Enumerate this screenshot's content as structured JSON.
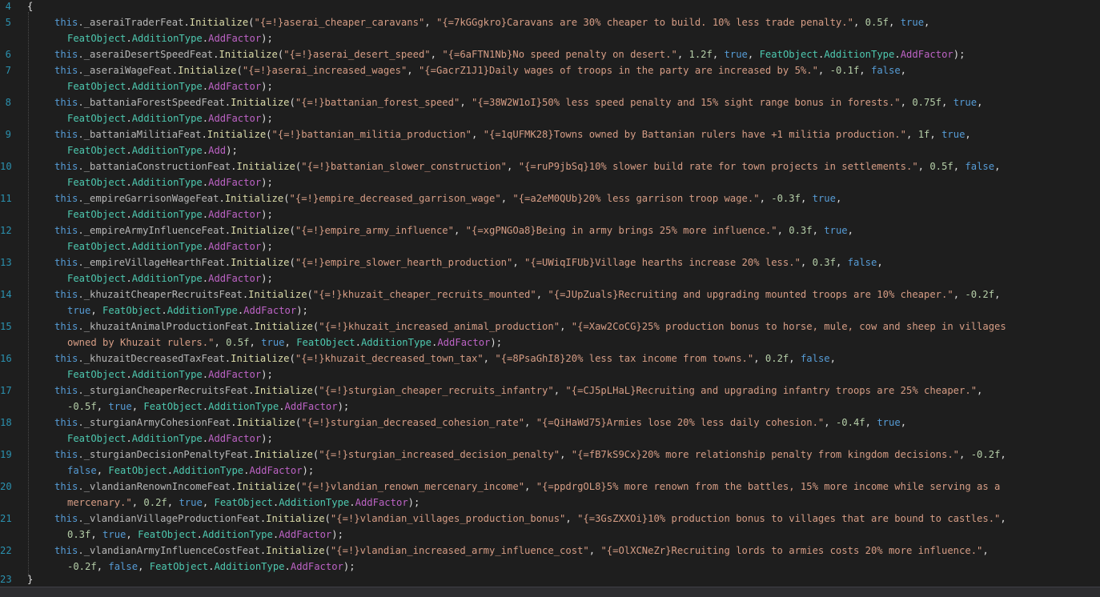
{
  "line_numbers": [
    "4",
    "5",
    "6",
    "7",
    "8",
    "9",
    "10",
    "11",
    "12",
    "13",
    "14",
    "15",
    "16",
    "17",
    "18",
    "19",
    "20",
    "21",
    "22",
    "23"
  ],
  "open_brace": "{",
  "close_brace": "}",
  "rows": [
    {
      "num": "5",
      "a": "this",
      "b": "._aseraiTraderFeat",
      "c": ".Initialize(",
      "d": "\"{=!}aserai_cheaper_caravans\"",
      "e": ", ",
      "f": "\"{=7kGGgkro}Caravans are 30% cheaper to build. 10% less trade penalty.\"",
      "g": ", ",
      "h": "0.5f",
      "i": ", ",
      "j": "true",
      "k": ",",
      "cont": "FeatObject.AdditionType.AddFactor);"
    },
    {
      "num": "6",
      "a": "this",
      "b": "._aseraiDesertSpeedFeat",
      "c": ".Initialize(",
      "d": "\"{=!}aserai_desert_speed\"",
      "e": ", ",
      "f": "\"{=6aFTN1Nb}No speed penalty on desert.\"",
      "g": ", ",
      "h": "1.2f",
      "i": ", ",
      "j": "true",
      "k": ", FeatObject.AdditionType.AddFactor);",
      "cont": ""
    },
    {
      "num": "7",
      "a": "this",
      "b": "._aseraiWageFeat",
      "c": ".Initialize(",
      "d": "\"{=!}aserai_increased_wages\"",
      "e": ", ",
      "f": "\"{=GacrZ1J1}Daily wages of troops in the party are increased by 5%.\"",
      "g": ", ",
      "h": "-0.1f",
      "i": ", ",
      "j": "false",
      "k": ",",
      "cont": "FeatObject.AdditionType.AddFactor);"
    },
    {
      "num": "8",
      "a": "this",
      "b": "._battaniaForestSpeedFeat",
      "c": ".Initialize(",
      "d": "\"{=!}battanian_forest_speed\"",
      "e": ", ",
      "f": "\"{=38W2W1oI}50% less speed penalty and 15% sight range bonus in forests.\"",
      "g": ", ",
      "h": "0.75f",
      "i": ", ",
      "j": "true",
      "k": ",",
      "cont": "FeatObject.AdditionType.AddFactor);"
    },
    {
      "num": "9",
      "a": "this",
      "b": "._battaniaMilitiaFeat",
      "c": ".Initialize(",
      "d": "\"{=!}battanian_militia_production\"",
      "e": ", ",
      "f": "\"{=1qUFMK28}Towns owned by Battanian rulers have +1 militia production.\"",
      "g": ", ",
      "h": "1f",
      "i": ", ",
      "j": "true",
      "k": ",",
      "cont": "FeatObject.AdditionType.Add);"
    },
    {
      "num": "10",
      "a": "this",
      "b": "._battaniaConstructionFeat",
      "c": ".Initialize(",
      "d": "\"{=!}battanian_slower_construction\"",
      "e": ", ",
      "f": "\"{=ruP9jbSq}10% slower build rate for town projects in settlements.\"",
      "g": ", ",
      "h": "0.5f",
      "i": ", ",
      "j": "false",
      "k": ",",
      "cont": "FeatObject.AdditionType.AddFactor);"
    },
    {
      "num": "11",
      "a": "this",
      "b": "._empireGarrisonWageFeat",
      "c": ".Initialize(",
      "d": "\"{=!}empire_decreased_garrison_wage\"",
      "e": ", ",
      "f": "\"{=a2eM0QUb}20% less garrison troop wage.\"",
      "g": ", ",
      "h": "-0.3f",
      "i": ", ",
      "j": "true",
      "k": ",",
      "cont": "FeatObject.AdditionType.AddFactor);"
    },
    {
      "num": "12",
      "a": "this",
      "b": "._empireArmyInfluenceFeat",
      "c": ".Initialize(",
      "d": "\"{=!}empire_army_influence\"",
      "e": ", ",
      "f": "\"{=xgPNGOa8}Being in army brings 25% more influence.\"",
      "g": ", ",
      "h": "0.3f",
      "i": ", ",
      "j": "true",
      "k": ",",
      "cont": "FeatObject.AdditionType.AddFactor);"
    },
    {
      "num": "13",
      "a": "this",
      "b": "._empireVillageHearthFeat",
      "c": ".Initialize(",
      "d": "\"{=!}empire_slower_hearth_production\"",
      "e": ", ",
      "f": "\"{=UWiqIFUb}Village hearths increase 20% less.\"",
      "g": ", ",
      "h": "0.3f",
      "i": ", ",
      "j": "false",
      "k": ",",
      "cont": "FeatObject.AdditionType.AddFactor);"
    },
    {
      "num": "14",
      "a": "this",
      "b": "._khuzaitCheaperRecruitsFeat",
      "c": ".Initialize(",
      "d": "\"{=!}khuzait_cheaper_recruits_mounted\"",
      "e": ", ",
      "f": "\"{=JUpZuals}Recruiting and upgrading mounted troops are 10% cheaper.\"",
      "g": ", ",
      "h": "-0.2f",
      "i": ",",
      "j": "",
      "k": "",
      "cont": "true, FeatObject.AdditionType.AddFactor);"
    },
    {
      "num": "15",
      "a": "this",
      "b": "._khuzaitAnimalProductionFeat",
      "c": ".Initialize(",
      "d": "\"{=!}khuzait_increased_animal_production\"",
      "e": ", ",
      "f": "\"{=Xaw2CoCG}25% production bonus to horse, mule, cow and sheep in villages",
      "g": "",
      "h": "",
      "i": "",
      "j": "",
      "k": "",
      "cont": "owned by Khuzait rulers.\", 0.5f, true, FeatObject.AdditionType.AddFactor);"
    },
    {
      "num": "16",
      "a": "this",
      "b": "._khuzaitDecreasedTaxFeat",
      "c": ".Initialize(",
      "d": "\"{=!}khuzait_decreased_town_tax\"",
      "e": ", ",
      "f": "\"{=8PsaGhI8}20% less tax income from towns.\"",
      "g": ", ",
      "h": "0.2f",
      "i": ", ",
      "j": "false",
      "k": ",",
      "cont": "FeatObject.AdditionType.AddFactor);"
    },
    {
      "num": "17",
      "a": "this",
      "b": "._sturgianCheaperRecruitsFeat",
      "c": ".Initialize(",
      "d": "\"{=!}sturgian_cheaper_recruits_infantry\"",
      "e": ", ",
      "f": "\"{=CJ5pLHaL}Recruiting and upgrading infantry troops are 25% cheaper.\"",
      "g": ",",
      "h": "",
      "i": "",
      "j": "",
      "k": "",
      "cont": "-0.5f, true, FeatObject.AdditionType.AddFactor);"
    },
    {
      "num": "18",
      "a": "this",
      "b": "._sturgianArmyCohesionFeat",
      "c": ".Initialize(",
      "d": "\"{=!}sturgian_decreased_cohesion_rate\"",
      "e": ", ",
      "f": "\"{=QiHaWd75}Armies lose 20% less daily cohesion.\"",
      "g": ", ",
      "h": "-0.4f",
      "i": ", ",
      "j": "true",
      "k": ",",
      "cont": "FeatObject.AdditionType.AddFactor);"
    },
    {
      "num": "19",
      "a": "this",
      "b": "._sturgianDecisionPenaltyFeat",
      "c": ".Initialize(",
      "d": "\"{=!}sturgian_increased_decision_penalty\"",
      "e": ", ",
      "f": "\"{=fB7kS9Cx}20% more relationship penalty from kingdom decisions.\"",
      "g": ", ",
      "h": "-0.2f",
      "i": ",",
      "j": "",
      "k": "",
      "cont": "false, FeatObject.AdditionType.AddFactor);"
    },
    {
      "num": "20",
      "a": "this",
      "b": "._vlandianRenownIncomeFeat",
      "c": ".Initialize(",
      "d": "\"{=!}vlandian_renown_mercenary_income\"",
      "e": ", ",
      "f": "\"{=ppdrgOL8}5% more renown from the battles, 15% more income while serving as a",
      "g": "",
      "h": "",
      "i": "",
      "j": "",
      "k": "",
      "cont": "mercenary.\", 0.2f, true, FeatObject.AdditionType.AddFactor);"
    },
    {
      "num": "21",
      "a": "this",
      "b": "._vlandianVillageProductionFeat",
      "c": ".Initialize(",
      "d": "\"{=!}vlandian_villages_production_bonus\"",
      "e": ", ",
      "f": "\"{=3GsZXXOi}10% production bonus to villages that are bound to castles.\"",
      "g": ",",
      "h": "",
      "i": "",
      "j": "",
      "k": "",
      "cont": "0.3f, true, FeatObject.AdditionType.AddFactor);"
    },
    {
      "num": "22",
      "a": "this",
      "b": "._vlandianArmyInfluenceCostFeat",
      "c": ".Initialize(",
      "d": "\"{=!}vlandian_increased_army_influence_cost\"",
      "e": ", ",
      "f": "\"{=OlXCNeZr}Recruiting lords to armies costs 20% more influence.\"",
      "g": ",",
      "h": "",
      "i": "",
      "j": "",
      "k": "",
      "cont": "-0.2f, false, FeatObject.AdditionType.AddFactor);"
    }
  ]
}
